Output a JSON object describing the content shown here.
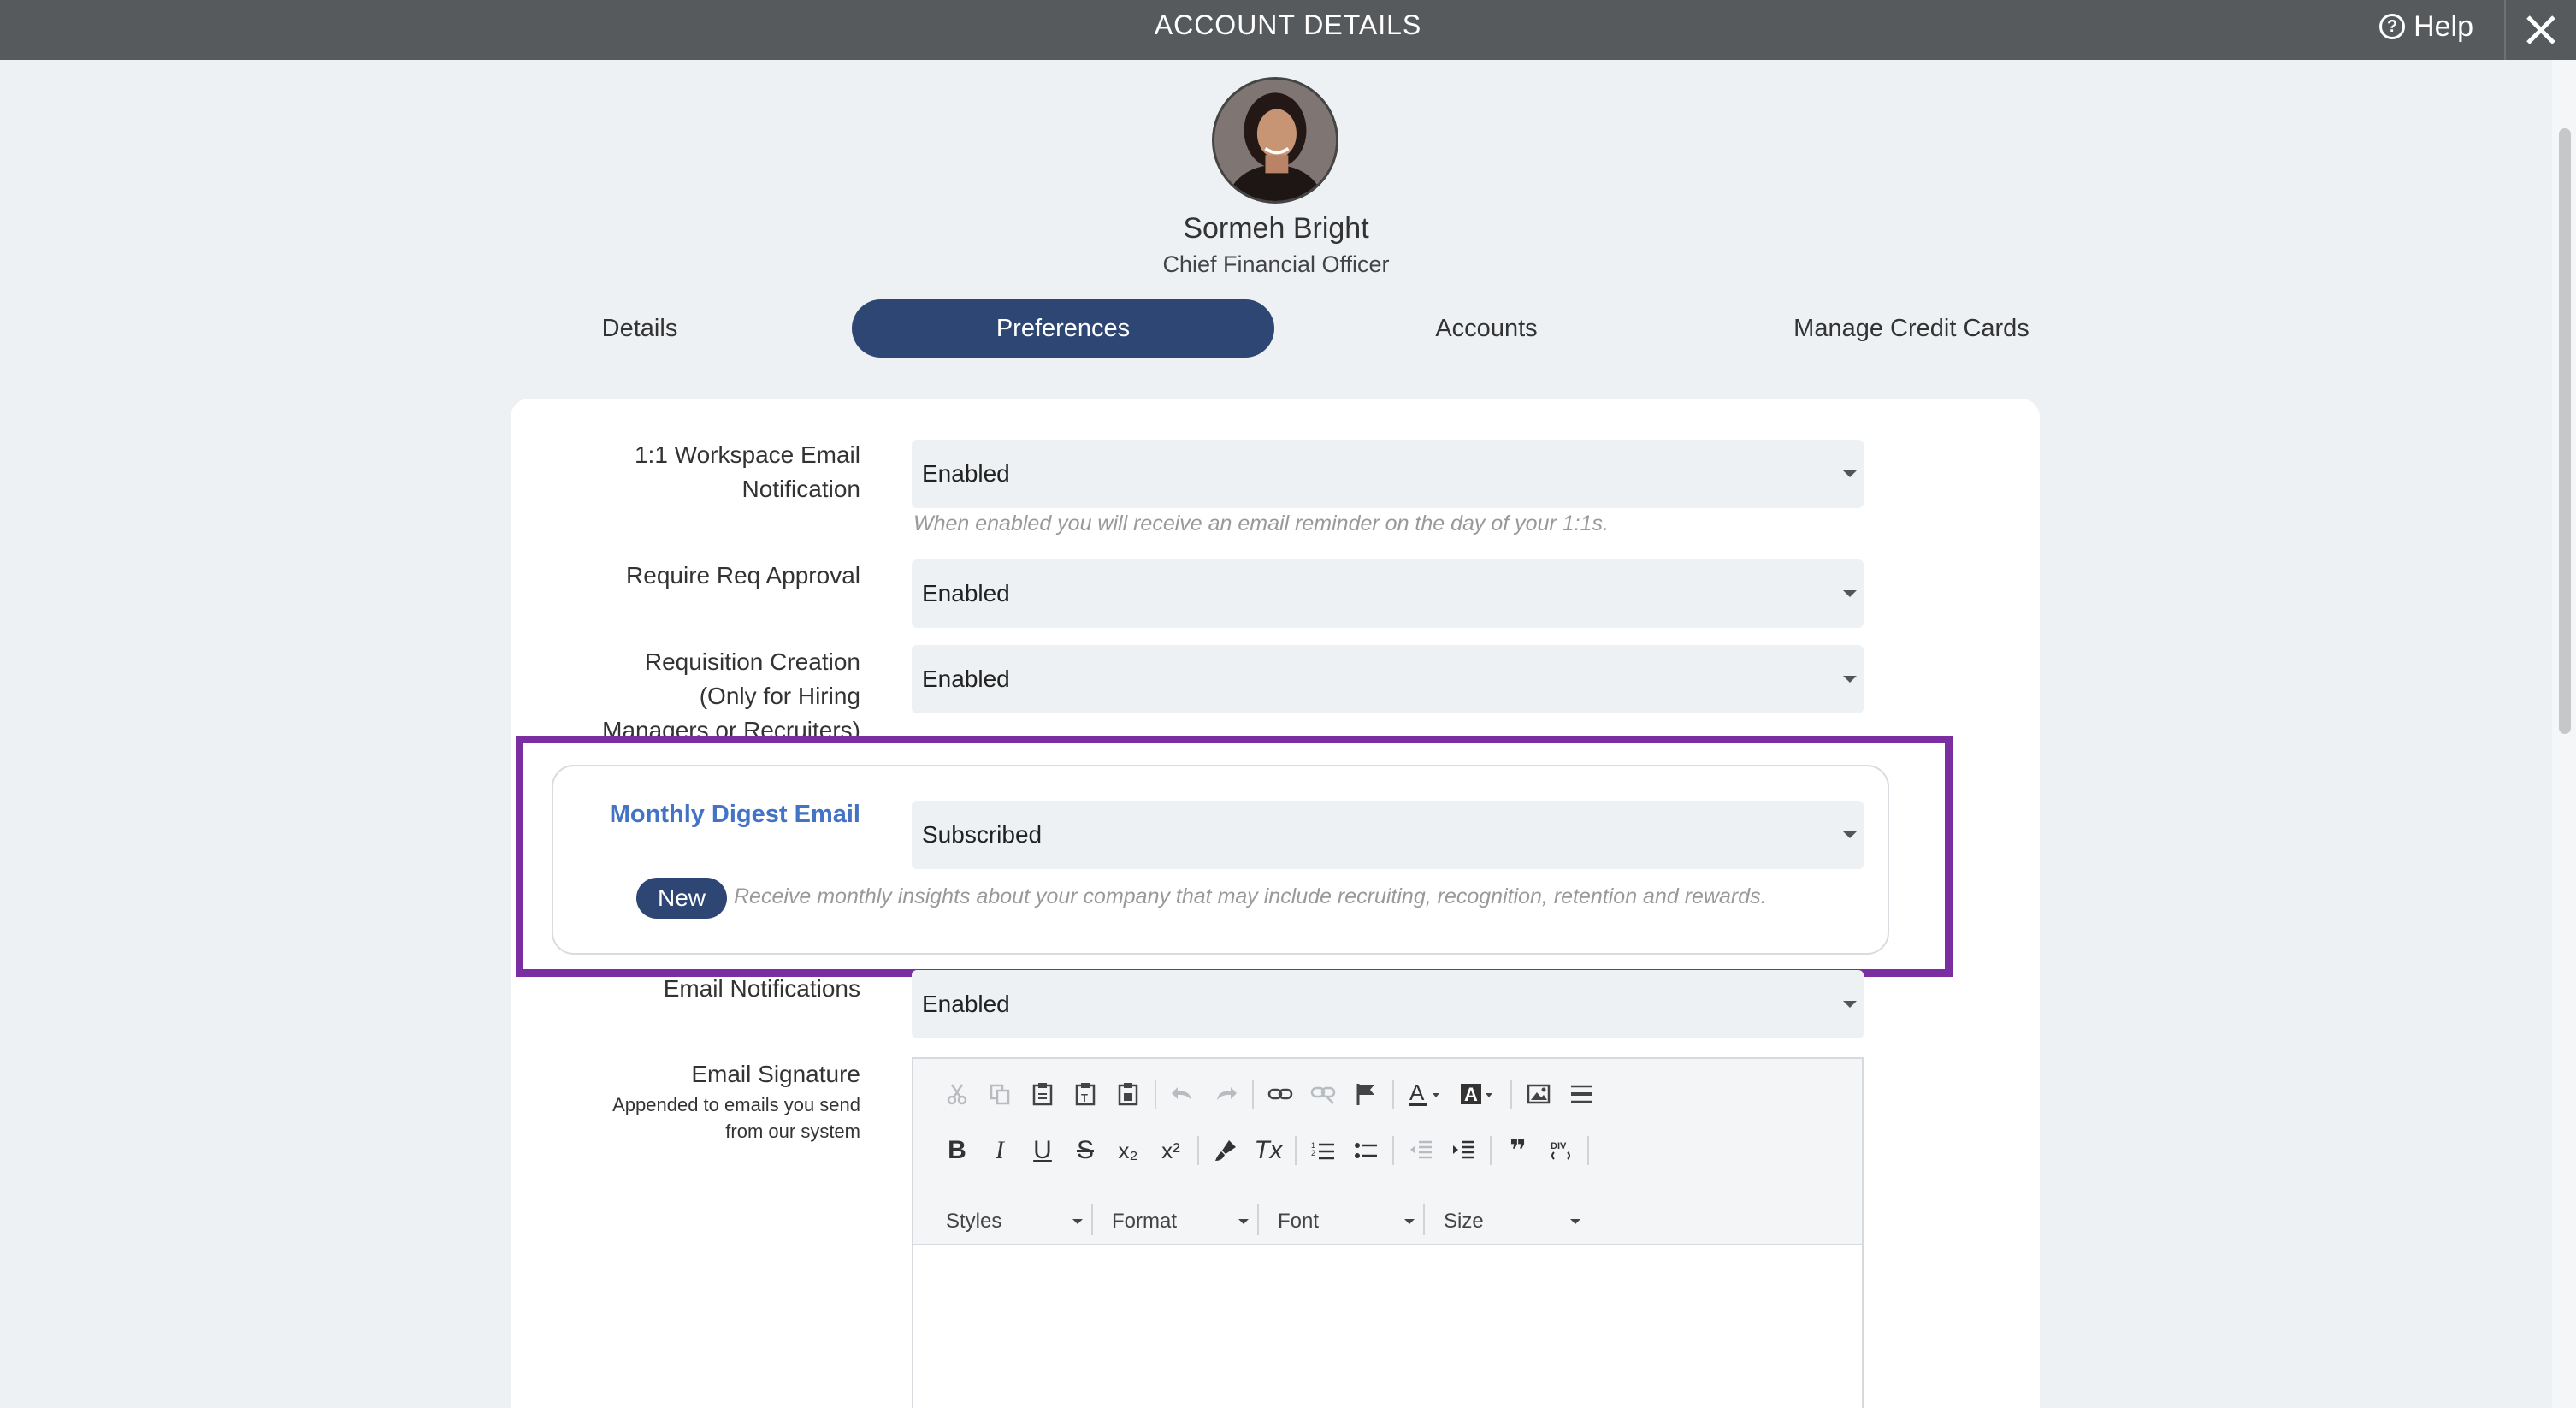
{
  "window": {
    "title": "ACCOUNT DETAILS",
    "help_label": "Help"
  },
  "profile": {
    "name": "Sormeh Bright",
    "job_title": "Chief Financial Officer"
  },
  "tabs": [
    {
      "label": "Details",
      "active": false
    },
    {
      "label": "Preferences",
      "active": true
    },
    {
      "label": "Accounts",
      "active": false
    },
    {
      "label": "Manage Credit Cards",
      "active": false
    }
  ],
  "preferences": {
    "workspace_email": {
      "label_line1": "1:1 Workspace Email",
      "label_line2": "Notification",
      "value": "Enabled",
      "hint": "When enabled you will receive an email reminder on the day of your 1:1s."
    },
    "req_approval": {
      "label": "Require Req Approval",
      "value": "Enabled"
    },
    "requisition_creation": {
      "label_line1": "Requisition Creation",
      "label_line2": "(Only for Hiring",
      "label_line3": "Managers or Recruiters)",
      "value": "Enabled"
    },
    "monthly_digest": {
      "label": "Monthly Digest Email",
      "value": "Subscribed",
      "badge": "New",
      "hint": "Receive monthly insights about your company that may include recruiting, recognition, retention and rewards."
    },
    "email_notifications": {
      "label": "Email Notifications",
      "value": "Enabled"
    },
    "email_signature": {
      "label": "Email Signature",
      "sub_line1": "Appended to emails you send",
      "sub_line2": "from our system"
    }
  },
  "editor": {
    "combos": {
      "styles": "Styles",
      "format": "Format",
      "font": "Font",
      "size": "Size"
    },
    "glyphs": {
      "bold": "B",
      "italic": "I",
      "underline": "U",
      "strike": "S",
      "subscript": "x₂",
      "superscript": "x²",
      "remove_format": "Tx",
      "quote": "❞",
      "font_color": "A",
      "bg_color": "A"
    }
  },
  "colors": {
    "accent": "#2d4673",
    "highlight": "#7b2ea1",
    "digest_label": "#4472c4",
    "titlebar": "#575a5d"
  }
}
